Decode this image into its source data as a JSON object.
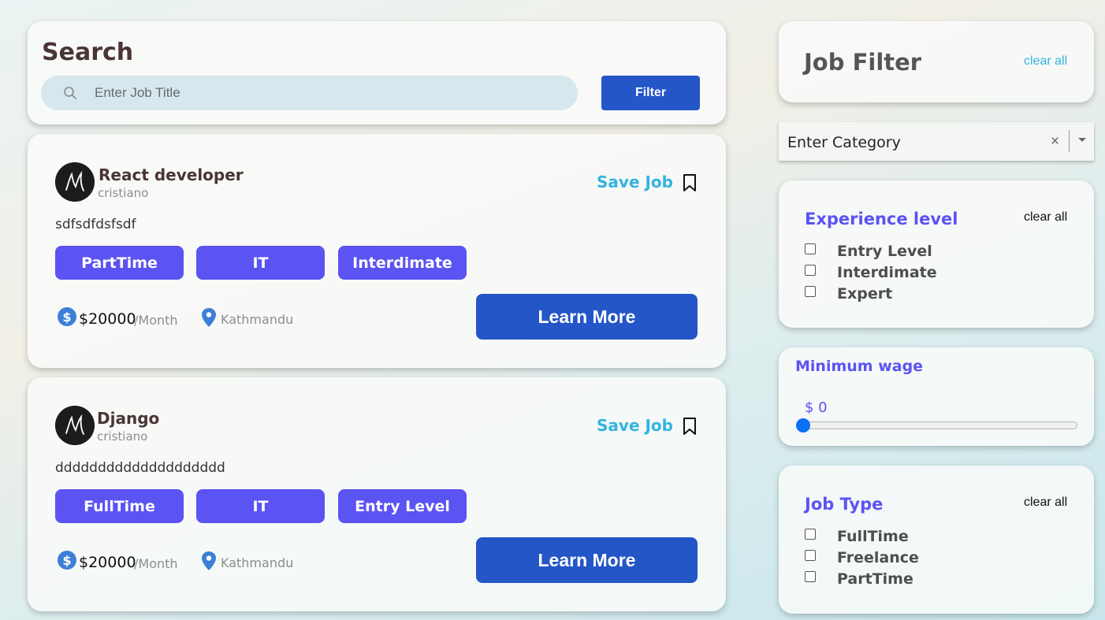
{
  "search": {
    "title": "Search",
    "placeholder": "Enter Job Title",
    "filter_label": "Filter"
  },
  "jobs": [
    {
      "title": "React developer",
      "company": "cristiano",
      "save_label": "Save Job",
      "description": "sdfsdfdsfsdf",
      "tags": [
        "PartTime",
        "IT",
        "Interdimate"
      ],
      "salary": "$20000",
      "period": "/Month",
      "location": "Kathmandu",
      "learn_more_label": "Learn More"
    },
    {
      "title": "Django",
      "company": "cristiano",
      "save_label": "Save Job",
      "description": "dddddddddddddddddddd",
      "tags": [
        "FullTime",
        "IT",
        "Entry Level"
      ],
      "salary": "$20000",
      "period": "/Month",
      "location": "Kathmandu",
      "learn_more_label": "Learn More"
    }
  ],
  "job_filter": {
    "title": "Job Filter",
    "clear_all": "clear all"
  },
  "category": {
    "value": "Enter Category",
    "clear_symbol": "×"
  },
  "experience": {
    "title": "Experience level",
    "clear_all": "clear all",
    "options": [
      "Entry Level",
      "Interdimate",
      "Expert"
    ]
  },
  "wage": {
    "title": "Minimum wage",
    "value": "$ 0",
    "slider_fraction": 0
  },
  "job_type": {
    "title": "Job Type",
    "clear_all": "clear all",
    "options": [
      "FullTime",
      "Freelance",
      "PartTime"
    ]
  },
  "colors": {
    "accent": "#5b53f2",
    "primary_button": "#2456c7",
    "link": "#34b3e0"
  }
}
